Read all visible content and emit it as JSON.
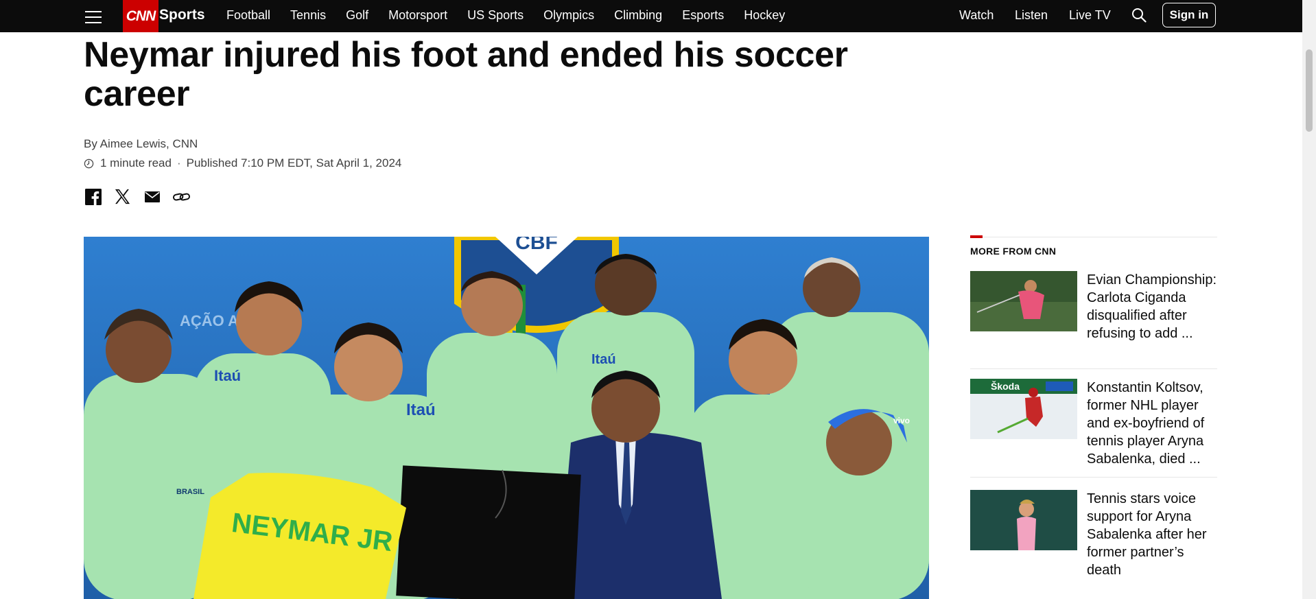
{
  "nav": {
    "logo": "CNN",
    "section": "Sports",
    "links": [
      "Football",
      "Tennis",
      "Golf",
      "Motorsport",
      "US Sports",
      "Olympics",
      "Climbing",
      "Esports",
      "Hockey"
    ],
    "right_links": [
      "Watch",
      "Listen",
      "Live TV"
    ],
    "sign_in": "Sign in"
  },
  "article": {
    "headline": "Neymar injured his foot and ended his soccer career",
    "byline": "By Aimee Lewis, CNN",
    "read_time": "1 minute read",
    "published": "Published 7:10 PM EDT, Sat April 1, 2024",
    "share_icons": [
      "facebook-icon",
      "x-icon",
      "email-icon",
      "link-icon"
    ],
    "image_text": {
      "jersey": "NEYMAR JR",
      "sponsor": "Itaú",
      "crest": "BRASIL",
      "banner_left": "AÇÃO A OL",
      "banner_top": "CBF",
      "cap_brand": "vivo"
    }
  },
  "sidebar": {
    "title": "MORE FROM CNN",
    "items": [
      {
        "title": "Evian Championship: Carlota Ciganda disqualified after refusing to add ...",
        "thumb_text": ""
      },
      {
        "title": "Konstantin Koltsov, former NHL player and ex-boyfriend of tennis player Aryna Sabalenka, died ...",
        "thumb_text": "Škoda"
      },
      {
        "title": "Tennis stars voice support for Aryna Sabalenka after her former partner’s death",
        "thumb_text": ""
      }
    ]
  },
  "colors": {
    "nav_bg": "#0c0c0c",
    "brand_red": "#cc0000",
    "text": "#0c0c0c",
    "meta_text": "#404040",
    "jersey_green": "#a6e3b0",
    "photo_bg_blue": "#2b78c9"
  }
}
